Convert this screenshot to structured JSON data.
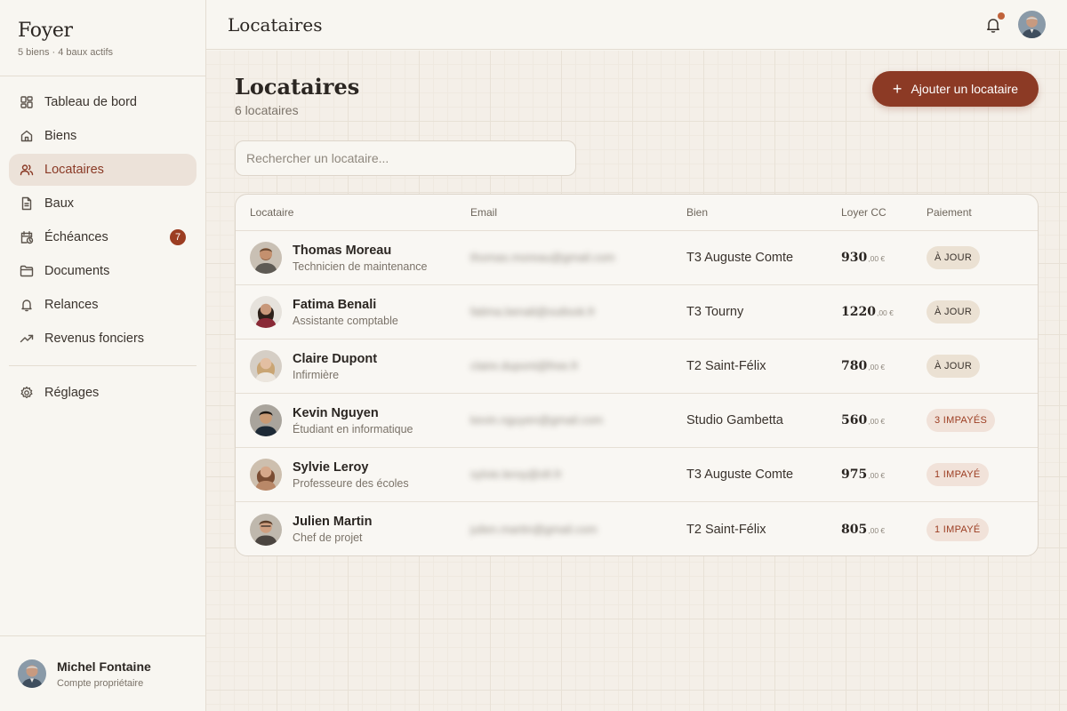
{
  "app": {
    "name": "Foyer",
    "subtitle": "5 biens · 4 baux actifs"
  },
  "sidebar": {
    "items": [
      {
        "label": "Tableau de bord",
        "icon": "dashboard-icon"
      },
      {
        "label": "Biens",
        "icon": "home-icon"
      },
      {
        "label": "Locataires",
        "icon": "users-icon",
        "active": true
      },
      {
        "label": "Baux",
        "icon": "document-icon"
      },
      {
        "label": "Échéances",
        "icon": "calendar-clock-icon",
        "badge": "7"
      },
      {
        "label": "Documents",
        "icon": "folder-icon"
      },
      {
        "label": "Relances",
        "icon": "bell-icon"
      },
      {
        "label": "Revenus fonciers",
        "icon": "trending-up-icon"
      }
    ],
    "settings": {
      "label": "Réglages",
      "icon": "gear-icon"
    },
    "user": {
      "name": "Michel Fontaine",
      "role": "Compte propriétaire"
    }
  },
  "header": {
    "title": "Locataires"
  },
  "main": {
    "title": "Locataires",
    "count_label": "6 locataires",
    "add_button_label": "Ajouter un locataire",
    "search_placeholder": "Rechercher un locataire..."
  },
  "table": {
    "columns": {
      "tenant": "Locataire",
      "email": "Email",
      "property": "Bien",
      "rent": "Loyer CC",
      "payment": "Paiement"
    },
    "rows": [
      {
        "name": "Thomas Moreau",
        "job": "Technicien de maintenance",
        "email": "thomas.moreau@gmail.com",
        "property": "T3 Auguste Comte",
        "rent": "930",
        "rent_dec": ",00 €",
        "status": "À JOUR",
        "status_type": "ok"
      },
      {
        "name": "Fatima Benali",
        "job": "Assistante comptable",
        "email": "fatima.benali@outlook.fr",
        "property": "T3 Tourny",
        "rent": "1220",
        "rent_dec": ",00 €",
        "status": "À JOUR",
        "status_type": "ok"
      },
      {
        "name": "Claire Dupont",
        "job": "Infirmière",
        "email": "claire.dupont@free.fr",
        "property": "T2 Saint-Félix",
        "rent": "780",
        "rent_dec": ",00 €",
        "status": "À JOUR",
        "status_type": "ok"
      },
      {
        "name": "Kevin Nguyen",
        "job": "Étudiant en informatique",
        "email": "kevin.nguyen@gmail.com",
        "property": "Studio Gambetta",
        "rent": "560",
        "rent_dec": ",00 €",
        "status": "3 IMPAYÉS",
        "status_type": "late"
      },
      {
        "name": "Sylvie Leroy",
        "job": "Professeure des écoles",
        "email": "sylvie.leroy@sfr.fr",
        "property": "T3 Auguste Comte",
        "rent": "975",
        "rent_dec": ",00 €",
        "status": "1 IMPAYÉ",
        "status_type": "late"
      },
      {
        "name": "Julien Martin",
        "job": "Chef de projet",
        "email": "julien.martin@gmail.com",
        "property": "T2 Saint-Félix",
        "rent": "805",
        "rent_dec": ",00 €",
        "status": "1 IMPAYÉ",
        "status_type": "late"
      }
    ]
  },
  "colors": {
    "accent": "#8c3a25",
    "badge_bg": "#9c3d22",
    "background": "#f4efe8",
    "sidebar_bg": "#f8f6f1"
  }
}
